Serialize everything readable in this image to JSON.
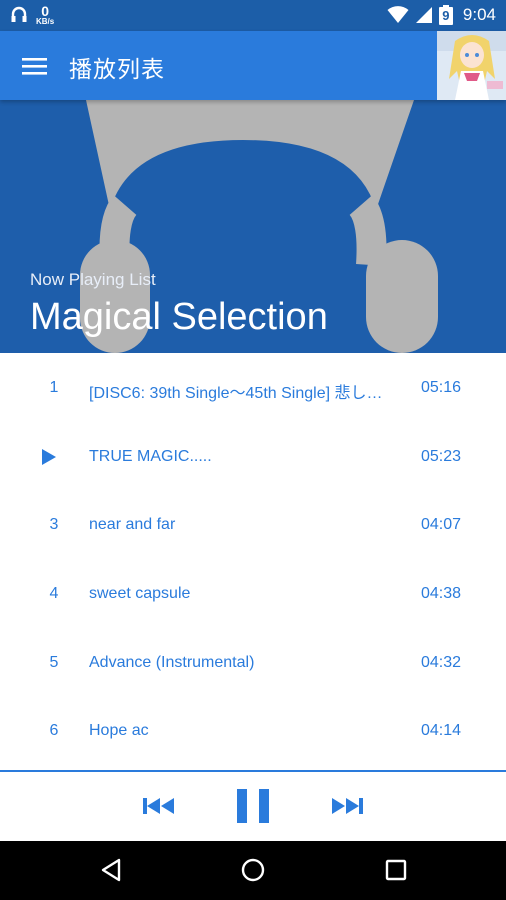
{
  "status_bar": {
    "net_speed_value": "0",
    "net_speed_unit": "KB/s",
    "battery_level": "9",
    "time": "9:04"
  },
  "app_bar": {
    "title": "播放列表"
  },
  "hero": {
    "subtitle": "Now Playing List",
    "title": "Magical Selection"
  },
  "tracks": [
    {
      "index": "1",
      "title": "[DISC6: 39th Single〜45th Single] 悲しみの…",
      "duration": "05:16",
      "playing": false
    },
    {
      "index": "2",
      "title": "TRUE MAGIC.....",
      "duration": "05:23",
      "playing": true
    },
    {
      "index": "3",
      "title": "near and far",
      "duration": "04:07",
      "playing": false
    },
    {
      "index": "4",
      "title": "sweet capsule",
      "duration": "04:38",
      "playing": false
    },
    {
      "index": "5",
      "title": "Advance (Instrumental)",
      "duration": "04:32",
      "playing": false
    },
    {
      "index": "6",
      "title": "Hope ac",
      "duration": "04:14",
      "playing": false
    }
  ],
  "colors": {
    "accent": "#2a7bdc",
    "status_bar": "#1c5ea8",
    "hero_bg": "#1e5eab",
    "headphone_gray": "#b4b4b4"
  },
  "icons": {
    "menu": "hamburger-menu-icon",
    "previous": "skip-previous-icon",
    "pause": "pause-icon",
    "next": "skip-next-icon",
    "back": "nav-back-icon",
    "home": "nav-home-icon",
    "recents": "nav-recents-icon"
  }
}
